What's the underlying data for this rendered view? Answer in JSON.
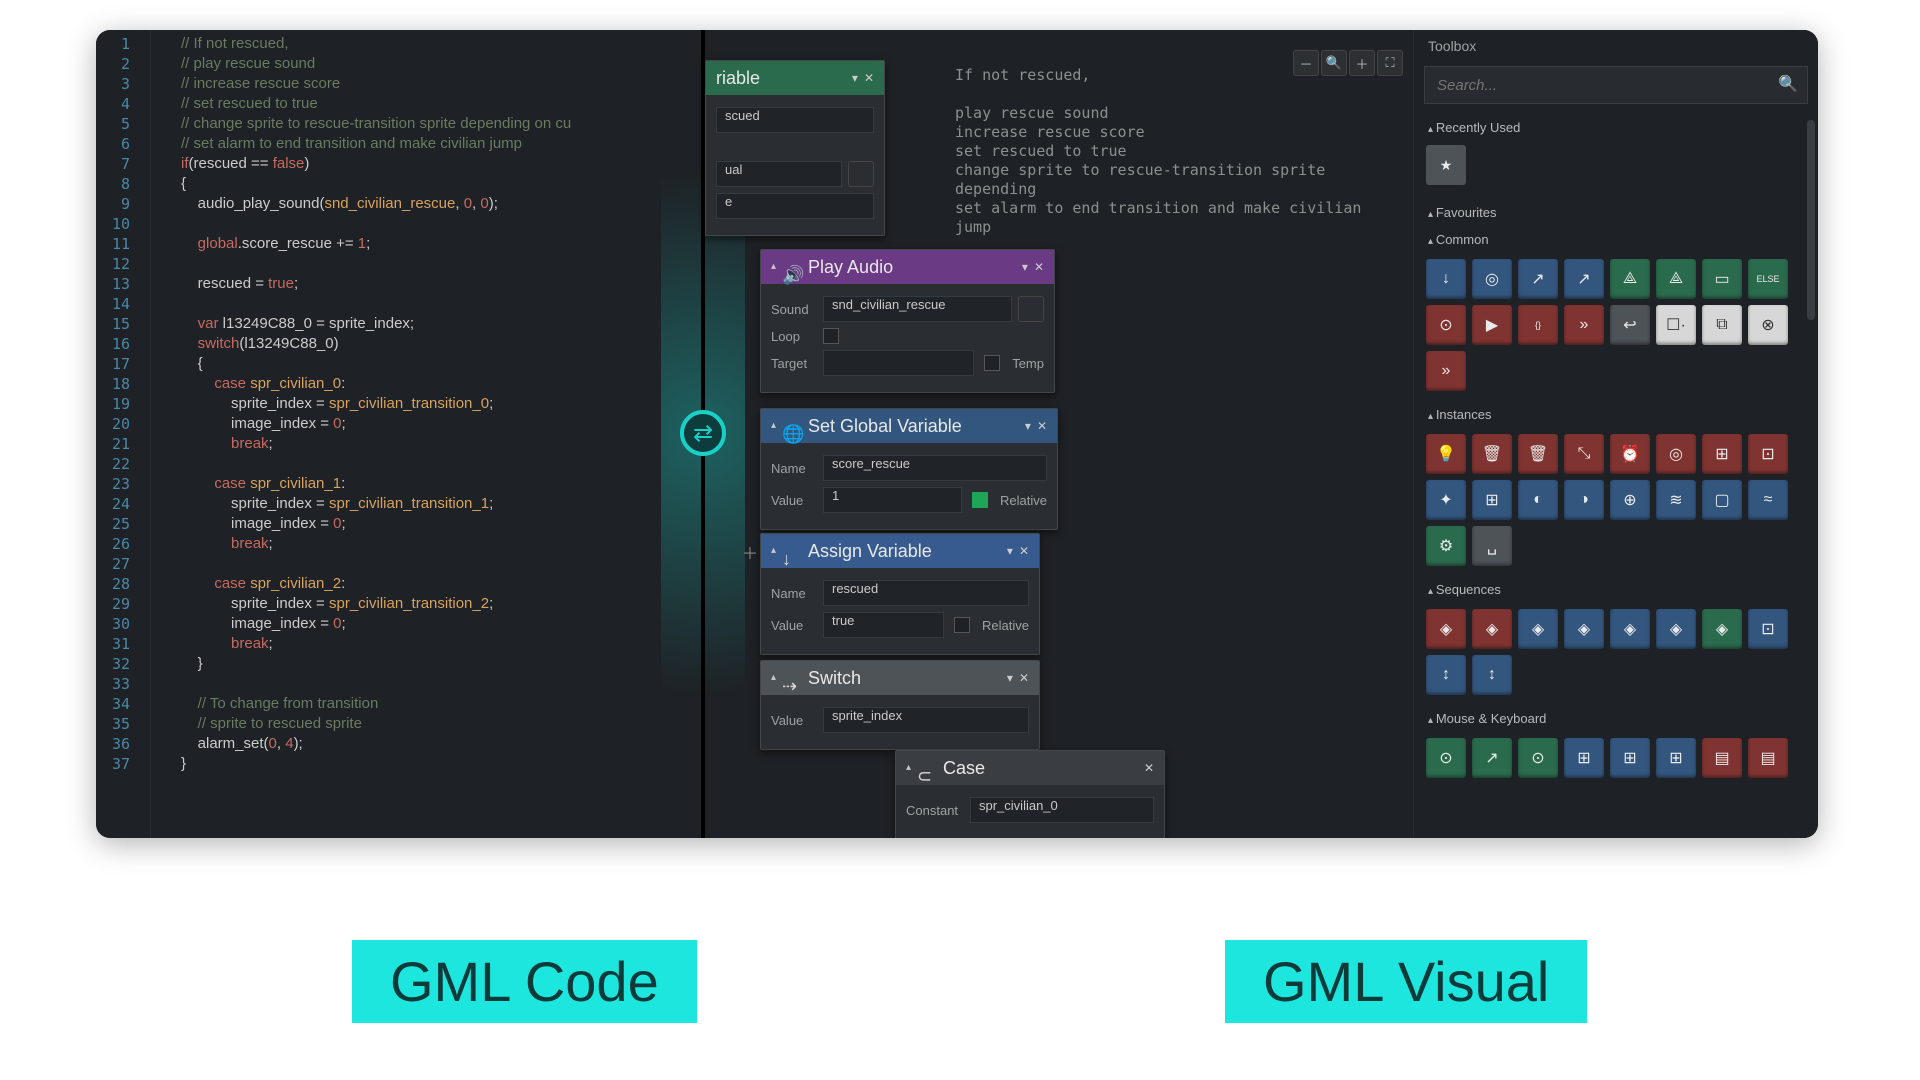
{
  "labels": {
    "left": "GML Code",
    "right": "GML Visual"
  },
  "code": {
    "lines": [
      {
        "t": "// If not rescued,",
        "cls": "c-comment"
      },
      {
        "t": "// play rescue sound",
        "cls": "c-comment"
      },
      {
        "t": "// increase rescue score",
        "cls": "c-comment"
      },
      {
        "t": "// set rescued to true",
        "cls": "c-comment"
      },
      {
        "t": "// change sprite to rescue-transition sprite depending on cu",
        "cls": "c-comment"
      },
      {
        "t": "// set alarm to end transition and make civilian jump",
        "cls": "c-comment"
      },
      {
        "raw": "<span class='c-kw'>if</span>(rescued == <span class='c-bool'>false</span>)"
      },
      {
        "t": "{"
      },
      {
        "raw": "    audio_play_sound(<span class='c-ident'>snd_civilian_rescue</span>, <span class='c-num'>0</span>, <span class='c-num'>0</span>);"
      },
      {
        "t": ""
      },
      {
        "raw": "    <span class='c-kw'>global</span>.score_rescue += <span class='c-num'>1</span>;"
      },
      {
        "t": ""
      },
      {
        "raw": "    rescued = <span class='c-bool'>true</span>;"
      },
      {
        "t": ""
      },
      {
        "raw": "    <span class='c-kw'>var</span> l13249C88_0 = sprite_index;"
      },
      {
        "raw": "    <span class='c-kw'>switch</span>(l13249C88_0)"
      },
      {
        "t": "    {"
      },
      {
        "raw": "        <span class='c-kw'>case</span> <span class='c-ident'>spr_civilian_0</span>:"
      },
      {
        "raw": "            sprite_index = <span class='c-ident'>spr_civilian_transition_0</span>;"
      },
      {
        "raw": "            image_index = <span class='c-num'>0</span>;"
      },
      {
        "raw": "            <span class='c-kw'>break</span>;"
      },
      {
        "t": ""
      },
      {
        "raw": "        <span class='c-kw'>case</span> <span class='c-ident'>spr_civilian_1</span>:"
      },
      {
        "raw": "            sprite_index = <span class='c-ident'>spr_civilian_transition_1</span>;"
      },
      {
        "raw": "            image_index = <span class='c-num'>0</span>;"
      },
      {
        "raw": "            <span class='c-kw'>break</span>;"
      },
      {
        "t": ""
      },
      {
        "raw": "        <span class='c-kw'>case</span> <span class='c-ident'>spr_civilian_2</span>:"
      },
      {
        "raw": "            sprite_index = <span class='c-ident'>spr_civilian_transition_2</span>;"
      },
      {
        "raw": "            image_index = <span class='c-num'>0</span>;"
      },
      {
        "raw": "            <span class='c-kw'>break</span>;"
      },
      {
        "t": "    }"
      },
      {
        "t": ""
      },
      {
        "t": "    // To change from transition",
        "cls": "c-comment"
      },
      {
        "t": "    // sprite to rescued sprite",
        "cls": "c-comment"
      },
      {
        "raw": "    alarm_set(<span class='c-num'>0</span>, <span class='c-num'>4</span>);"
      },
      {
        "t": "}"
      }
    ]
  },
  "visual_comments": [
    "If not rescued,",
    "",
    "play rescue sound",
    "increase rescue score",
    "set rescued to true",
    "change sprite to rescue-transition sprite depending",
    "set alarm to end transition and make civilian jump"
  ],
  "nodes": {
    "if_var": {
      "title": "riable",
      "fields": {
        "a": "scued",
        "b": "ual",
        "c": "e"
      }
    },
    "play_audio": {
      "title": "Play Audio",
      "sound": "snd_civilian_rescue",
      "loop": "",
      "target": "",
      "temp_label": "Temp"
    },
    "set_global": {
      "title": "Set Global Variable",
      "name": "score_rescue",
      "value": "1",
      "relative_label": "Relative"
    },
    "assign": {
      "title": "Assign Variable",
      "name": "rescued",
      "value": "true",
      "relative_label": "Relative"
    },
    "switch": {
      "title": "Switch",
      "value": "sprite_index"
    },
    "case0": {
      "title": "Case",
      "constant": "spr_civilian_0"
    }
  },
  "toolbox": {
    "title": "Toolbox",
    "search_placeholder": "Search...",
    "sections": [
      {
        "name": "Recently Used",
        "tiles": [
          {
            "g": "★",
            "c": "t-grey"
          }
        ]
      },
      {
        "name": "Favourites",
        "tiles": []
      },
      {
        "name": "Common",
        "tiles": [
          {
            "g": "↓",
            "c": "t-blue"
          },
          {
            "g": "◎",
            "c": "t-blue"
          },
          {
            "g": "↗",
            "c": "t-blue"
          },
          {
            "g": "↗",
            "c": "t-blue"
          },
          {
            "g": "⟁",
            "c": "t-green"
          },
          {
            "g": "⟁",
            "c": "t-green"
          },
          {
            "g": "▭",
            "c": "t-green"
          },
          {
            "g": "ELSE",
            "c": "t-green",
            "sm": 1
          },
          {
            "g": "⊙",
            "c": "t-red"
          },
          {
            "g": "▶",
            "c": "t-red"
          },
          {
            "g": "{}",
            "c": "t-red",
            "sm": 1
          },
          {
            "g": "»",
            "c": "t-red"
          },
          {
            "g": "↩",
            "c": "t-grey"
          },
          {
            "g": "☐·",
            "c": "t-white"
          },
          {
            "g": "⧉",
            "c": "t-white"
          },
          {
            "g": "⊗",
            "c": "t-white"
          },
          {
            "g": "»",
            "c": "t-red"
          }
        ]
      },
      {
        "name": "Instances",
        "tiles": [
          {
            "g": "💡",
            "c": "t-red"
          },
          {
            "g": "🗑",
            "c": "t-red"
          },
          {
            "g": "🗑",
            "c": "t-red"
          },
          {
            "g": "⤡",
            "c": "t-red"
          },
          {
            "g": "⏰",
            "c": "t-red"
          },
          {
            "g": "◎",
            "c": "t-red"
          },
          {
            "g": "⊞",
            "c": "t-red"
          },
          {
            "g": "⊡",
            "c": "t-red"
          },
          {
            "g": "✦",
            "c": "t-blue"
          },
          {
            "g": "⊞",
            "c": "t-blue"
          },
          {
            "g": "◐",
            "c": "t-blue"
          },
          {
            "g": "◑",
            "c": "t-blue"
          },
          {
            "g": "⊕",
            "c": "t-blue"
          },
          {
            "g": "≋",
            "c": "t-blue"
          },
          {
            "g": "▢",
            "c": "t-blue"
          },
          {
            "g": "≈",
            "c": "t-blue"
          },
          {
            "g": "⚙",
            "c": "t-green"
          },
          {
            "g": "␣",
            "c": "t-grey"
          }
        ]
      },
      {
        "name": "Sequences",
        "tiles": [
          {
            "g": "◈",
            "c": "t-red"
          },
          {
            "g": "◈",
            "c": "t-red"
          },
          {
            "g": "◈",
            "c": "t-blue"
          },
          {
            "g": "◈",
            "c": "t-blue"
          },
          {
            "g": "◈",
            "c": "t-blue"
          },
          {
            "g": "◈",
            "c": "t-blue"
          },
          {
            "g": "◈",
            "c": "t-green"
          },
          {
            "g": "⊡",
            "c": "t-blue"
          },
          {
            "g": "↕",
            "c": "t-blue"
          },
          {
            "g": "↕",
            "c": "t-blue"
          }
        ]
      },
      {
        "name": "Mouse & Keyboard",
        "tiles": [
          {
            "g": "⊙",
            "c": "t-green"
          },
          {
            "g": "↗",
            "c": "t-green"
          },
          {
            "g": "⊙",
            "c": "t-green"
          },
          {
            "g": "⊞",
            "c": "t-blue"
          },
          {
            "g": "⊞",
            "c": "t-blue"
          },
          {
            "g": "⊞",
            "c": "t-blue"
          },
          {
            "g": "▤",
            "c": "t-red"
          },
          {
            "g": "▤",
            "c": "t-red"
          }
        ]
      }
    ]
  },
  "zoom": {
    "buttons": [
      "🔍",
      "🔍",
      "🔍",
      "⛶"
    ]
  }
}
